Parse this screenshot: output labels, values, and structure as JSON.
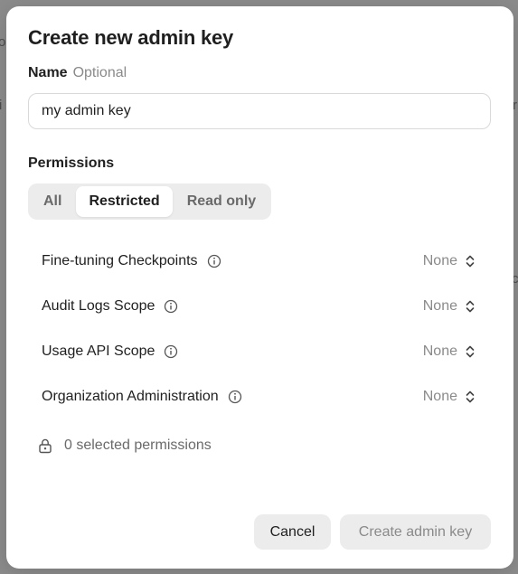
{
  "dialog": {
    "title": "Create new admin key",
    "name_label": "Name",
    "name_optional": "Optional",
    "name_value": "my admin key",
    "permissions_label": "Permissions",
    "tabs": [
      {
        "label": "All",
        "active": false
      },
      {
        "label": "Restricted",
        "active": true
      },
      {
        "label": "Read only",
        "active": false
      }
    ],
    "permissions": [
      {
        "label": "Fine-tuning Checkpoints",
        "value": "None"
      },
      {
        "label": "Audit Logs Scope",
        "value": "None"
      },
      {
        "label": "Usage API Scope",
        "value": "None"
      },
      {
        "label": "Organization Administration",
        "value": "None"
      }
    ],
    "selected_count_text": "0 selected permissions",
    "cancel_label": "Cancel",
    "create_label": "Create admin key"
  },
  "icons": {
    "info": "info-icon",
    "chevron": "chevron-up-down-icon",
    "lock": "lock-icon"
  },
  "colors": {
    "backdrop": "#8c8c8c",
    "modal_bg": "#ffffff",
    "muted_text": "#8a8a8a",
    "segment_bg": "#ececec"
  }
}
